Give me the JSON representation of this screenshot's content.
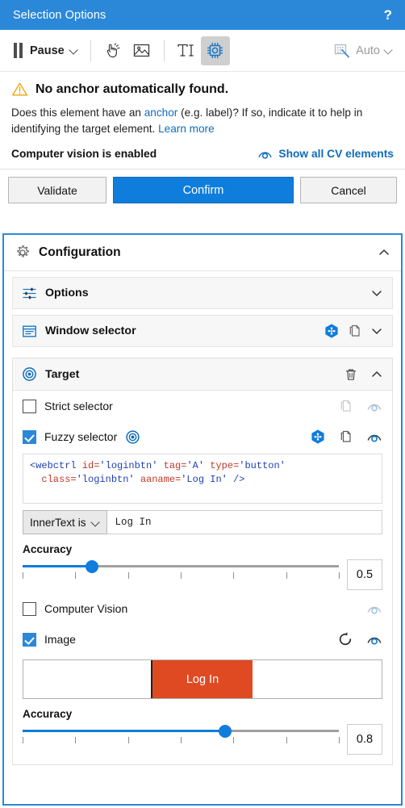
{
  "window": {
    "title": "Selection Options",
    "help_label": "?"
  },
  "toolbar": {
    "pause_label": "Pause",
    "pause_icon": "pause-icon",
    "pause_chevron_icon": "chevron-down-icon",
    "indicate_icon": "indicate-on-screen-icon",
    "image_icon": "image-region-icon",
    "text_icon": "text-cursor-icon",
    "cv_icon": "computer-vision-chip-icon",
    "auto_label": "Auto",
    "auto_icon": "auto-select-icon",
    "auto_chevron_icon": "chevron-down-icon"
  },
  "message": {
    "warning_icon": "warning-triangle-icon",
    "headline": "No anchor automatically found.",
    "description_part1": "Does this element have an ",
    "description_link1": "anchor",
    "description_part2": " (e.g. label)? If so, indicate it to help in identifying the target element. ",
    "description_link2": "Learn more",
    "cv_status": "Computer vision is enabled",
    "cv_link": "Show all CV elements",
    "cv_link_icon": "indicate-element-icon"
  },
  "actions": {
    "validate_label": "Validate",
    "confirm_label": "Confirm",
    "cancel_label": "Cancel"
  },
  "configuration": {
    "icon": "gear-icon",
    "title": "Configuration",
    "collapse_icon": "chevron-up-icon",
    "options": {
      "icon": "sliders-icon",
      "label": "Options",
      "expand_icon": "chevron-down-icon"
    },
    "window_selector": {
      "icon": "window-selector-icon",
      "label": "Window selector",
      "variable_icon": "variable-hexagon-icon",
      "copy_icon": "copy-icon",
      "expand_icon": "chevron-down-icon"
    },
    "target": {
      "icon": "target-icon",
      "label": "Target",
      "delete_icon": "trash-icon",
      "collapse_icon": "chevron-up-icon",
      "strict_selector": {
        "label": "Strict selector",
        "checked": false,
        "copy_icon": "copy-icon",
        "indicate_icon": "indicate-element-icon"
      },
      "fuzzy_selector": {
        "label": "Fuzzy selector",
        "checked": true,
        "target_icon": "target-icon",
        "variable_icon": "variable-hexagon-icon",
        "copy_icon": "copy-icon",
        "indicate_icon": "indicate-element-icon",
        "selector_code": {
          "line1": {
            "tag_open": "<webctrl",
            "attrs": [
              {
                "name": " id=",
                "value": "'loginbtn'"
              },
              {
                "name": " tag=",
                "value": "'A'"
              },
              {
                "name": " type=",
                "value": "'button'"
              }
            ]
          },
          "line2": {
            "attrs": [
              {
                "name": "  class=",
                "value": "'loginbtn'"
              },
              {
                "name": " aaname=",
                "value": "'Log In'"
              }
            ],
            "tag_close": " />"
          }
        },
        "filter_dropdown": "InnerText is",
        "filter_dropdown_icon": "chevron-down-icon",
        "filter_value": "Log In",
        "accuracy_label": "Accuracy",
        "accuracy_value": "0.5",
        "accuracy_percent": 50,
        "tick_count": 7
      },
      "computer_vision": {
        "label": "Computer Vision",
        "checked": false,
        "indicate_icon": "indicate-element-icon"
      },
      "image": {
        "label": "Image",
        "checked": true,
        "refresh_icon": "refresh-icon",
        "indicate_icon": "indicate-element-icon",
        "preview_button_label": "Log In",
        "preview_button_color": "#e04a23",
        "accuracy_label": "Accuracy",
        "accuracy_value": "0.8",
        "accuracy_percent": 80,
        "tick_count": 7
      }
    }
  },
  "colors": {
    "titlebar": "#2b88d8",
    "accent": "#0f7ddb",
    "link": "#0f6cbd",
    "warning": "#f0a30a",
    "image_button": "#e04a23"
  }
}
